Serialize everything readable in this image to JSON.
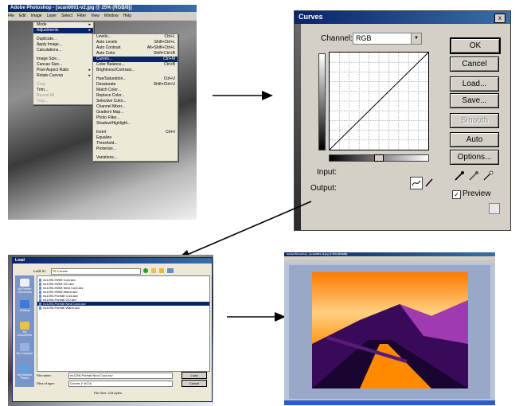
{
  "photoshop_menu": {
    "title": "Adobe Photoshop - [scan0001-v2.jpg @ 25% (RGB/8)]",
    "menubar": [
      "File",
      "Edit",
      "Image",
      "Layer",
      "Select",
      "Filter",
      "View",
      "Window",
      "Help"
    ],
    "image_menu": [
      "Mode",
      "Adjustments",
      "Duplicate...",
      "Apply Image...",
      "Calculations...",
      "Image Size...",
      "Canvas Size...",
      "Pixel Aspect Ratio",
      "Rotate Canvas",
      "Crop",
      "Trim...",
      "Reveal All",
      "Trap..."
    ],
    "adjustments_menu": [
      {
        "label": "Levels...",
        "shortcut": "Ctrl+L"
      },
      {
        "label": "Auto Levels",
        "shortcut": "Shift+Ctrl+L"
      },
      {
        "label": "Auto Contrast",
        "shortcut": "Alt+Shift+Ctrl+L"
      },
      {
        "label": "Auto Color",
        "shortcut": "Shift+Ctrl+B"
      },
      {
        "label": "Curves...",
        "shortcut": "Ctrl+M"
      },
      {
        "label": "Color Balance...",
        "shortcut": "Ctrl+B"
      },
      {
        "label": "Brightness/Contrast...",
        "shortcut": ""
      },
      {
        "label": "Hue/Saturation...",
        "shortcut": "Ctrl+U"
      },
      {
        "label": "Desaturate",
        "shortcut": "Shift+Ctrl+U"
      },
      {
        "label": "Match Color...",
        "shortcut": ""
      },
      {
        "label": "Replace Color...",
        "shortcut": ""
      },
      {
        "label": "Selective Color...",
        "shortcut": ""
      },
      {
        "label": "Channel Mixer...",
        "shortcut": ""
      },
      {
        "label": "Gradient Map...",
        "shortcut": ""
      },
      {
        "label": "Photo Filter...",
        "shortcut": ""
      },
      {
        "label": "Shadow/Highlight...",
        "shortcut": ""
      },
      {
        "label": "Invert",
        "shortcut": "Ctrl+I"
      },
      {
        "label": "Equalize",
        "shortcut": ""
      },
      {
        "label": "Threshold...",
        "shortcut": ""
      },
      {
        "label": "Posterize...",
        "shortcut": ""
      },
      {
        "label": "Variations...",
        "shortcut": ""
      }
    ]
  },
  "curves_dialog": {
    "title": "Curves",
    "close": "x",
    "channel_label": "Channel:",
    "channel_value": "RGB",
    "buttons": {
      "ok": "OK",
      "cancel": "Cancel",
      "load": "Load...",
      "save": "Save...",
      "smooth": "Smooth",
      "auto": "Auto",
      "options": "Options..."
    },
    "input_label": "Input:",
    "output_label": "Output:",
    "preview_label": "Preview",
    "preview_checked": true
  },
  "load_dialog": {
    "title": "Load",
    "look_in_label": "Look in:",
    "look_in_value": "Curves",
    "places": [
      "My Recent Documents",
      "Desktop",
      "My Documents",
      "My Computer",
      "My Network Places"
    ],
    "files": [
      "ns1290-HWM Cool.acv",
      "ns1290-HWM GO.acv",
      "ns1290-HWM Neut Cool.acv",
      "ns1290-HWM Warm.acv",
      "ns1290-Portrait Cool.acv",
      "ns1290-Portrait GO.acv",
      "ns1290-Portrait Neut Cool.acv",
      "ns1290-Portrait Warm.acv"
    ],
    "selected_index": 6,
    "file_name_label": "File name:",
    "file_name_value": "ns1290-Portrait Neut Cool.acv",
    "file_type_label": "Files of type:",
    "file_type_value": "Curves (*.ACV)",
    "load_button": "Load",
    "cancel_button": "Cancel",
    "file_size": "File Size: 218 bytes"
  },
  "result_window": {
    "title": "Adobe Photoshop - [scan0001-v2.jpg @ 25% (RGB/8)]"
  }
}
